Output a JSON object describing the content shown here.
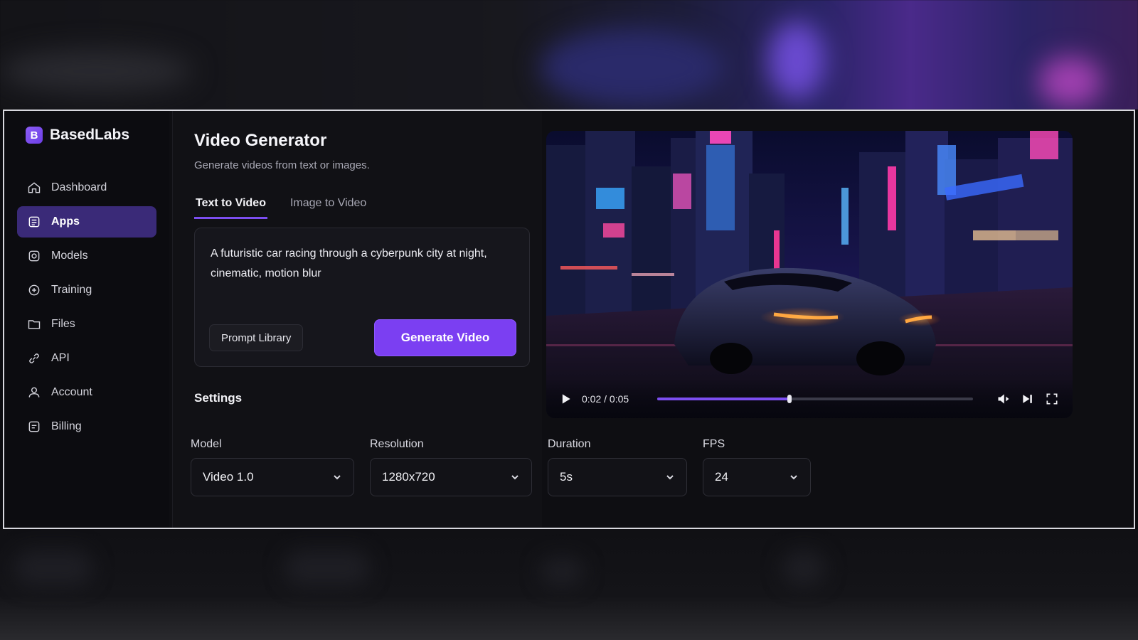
{
  "brand": {
    "name": "BasedLabs",
    "logo_letter": "B",
    "accent": "#7b3ff2"
  },
  "sidebar": {
    "items": [
      {
        "label": "Dashboard",
        "icon": "home-icon",
        "active": false
      },
      {
        "label": "Apps",
        "icon": "apps-icon",
        "active": true
      },
      {
        "label": "Models",
        "icon": "models-icon",
        "active": false
      },
      {
        "label": "Training",
        "icon": "training-icon",
        "active": false
      },
      {
        "label": "Files",
        "icon": "folder-icon",
        "active": false
      },
      {
        "label": "API",
        "icon": "link-icon",
        "active": false
      },
      {
        "label": "Account",
        "icon": "user-icon",
        "active": false
      },
      {
        "label": "Billing",
        "icon": "billing-icon",
        "active": false
      }
    ]
  },
  "main": {
    "title": "Video Generator",
    "subtitle": "Generate videos from text or images.",
    "tabs": [
      {
        "label": "Text to Video",
        "active": true
      },
      {
        "label": "Image to Video",
        "active": false
      }
    ],
    "prompt": {
      "value": "A futuristic car racing through a cyberpunk city at night, cinematic, motion blur"
    },
    "prompt_library_label": "Prompt Library",
    "generate_label": "Generate Video",
    "settings_title": "Settings"
  },
  "settings": {
    "model": {
      "label": "Model",
      "value": "Video 1.0"
    },
    "resolution": {
      "label": "Resolution",
      "value": "1280x720"
    },
    "duration": {
      "label": "Duration",
      "value": "5s"
    },
    "fps": {
      "label": "FPS",
      "value": "24"
    }
  },
  "player": {
    "time": "0:02 / 0:05",
    "progress": 0.42
  }
}
